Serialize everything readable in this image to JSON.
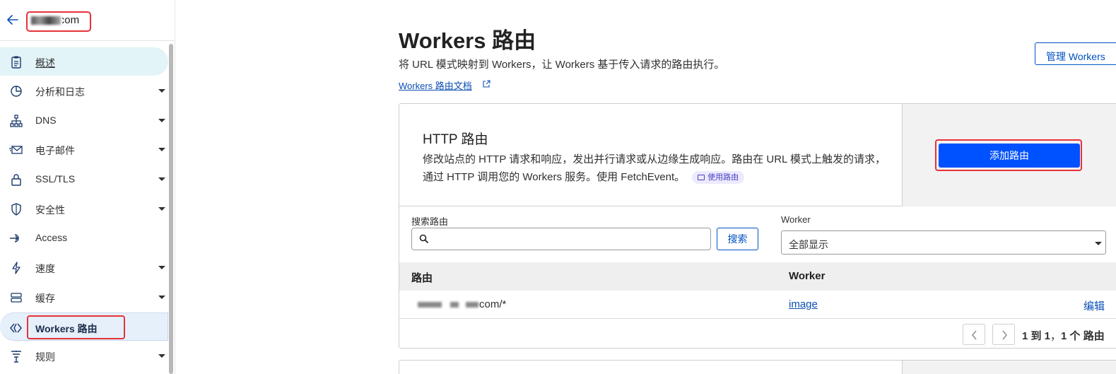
{
  "sidebar": {
    "domain": "f___y.com",
    "items": [
      {
        "label": "概述",
        "icon": "clipboard-icon",
        "caret": false
      },
      {
        "label": "分析和日志",
        "icon": "pie-chart-icon",
        "caret": true
      },
      {
        "label": "DNS",
        "icon": "network-icon",
        "caret": true
      },
      {
        "label": "电子邮件",
        "icon": "mail-icon",
        "caret": true
      },
      {
        "label": "SSL/TLS",
        "icon": "lock-icon",
        "caret": true
      },
      {
        "label": "安全性",
        "icon": "shield-icon",
        "caret": true
      },
      {
        "label": "Access",
        "icon": "access-icon",
        "caret": false
      },
      {
        "label": "速度",
        "icon": "lightning-icon",
        "caret": true
      },
      {
        "label": "缓存",
        "icon": "server-icon",
        "caret": true
      },
      {
        "label": "Workers 路由",
        "icon": "workers-icon",
        "caret": false
      },
      {
        "label": "规则",
        "icon": "rules-icon",
        "caret": true
      }
    ]
  },
  "header": {
    "title": "Workers 路由",
    "description": "将 URL 模式映射到 Workers，让 Workers 基于传入请求的路由执行。",
    "doc_link": "Workers 路由文档",
    "manage_button": "管理 Workers"
  },
  "http_routes": {
    "title": "HTTP 路由",
    "description": "修改站点的 HTTP 请求和响应，发出并行请求或从边缘生成响应。路由在 URL 模式上触发的请求，通过 HTTP 调用您的 Workers 服务。使用 FetchEvent。",
    "chip": "使用路由",
    "add_button": "添加路由"
  },
  "filters": {
    "search_label": "搜索路由",
    "search_placeholder": "",
    "search_button": "搜索",
    "worker_label": "Worker",
    "worker_selected": "全部显示"
  },
  "table": {
    "headers": [
      "路由",
      "Worker"
    ],
    "rows": [
      {
        "route_suffix": "com/*",
        "worker": "image",
        "action": "编辑"
      }
    ]
  },
  "pagination": {
    "text_prefix": "1 到 1",
    "text_suffix": "1 个 路由"
  },
  "colors": {
    "primary": "#0051ff",
    "link": "#0b4fb4",
    "highlight_border": "#e5333a"
  }
}
